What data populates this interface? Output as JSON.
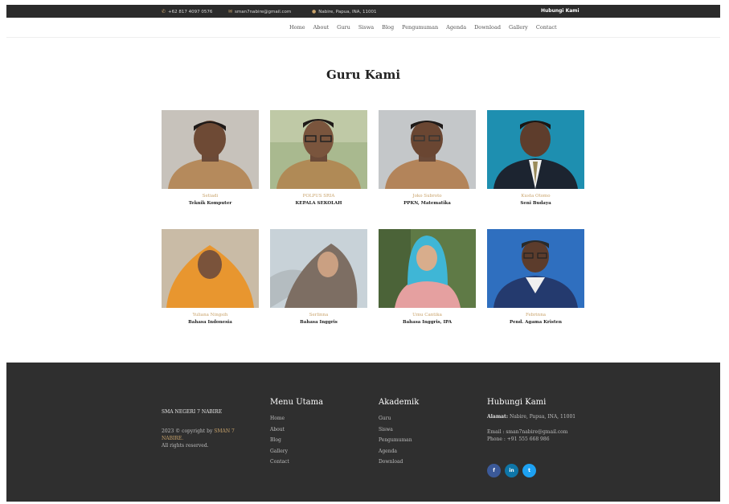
{
  "topbar": {
    "phone": "+62 817 4097 0576",
    "email": "sman7nabire@gmail.com",
    "address": "Nabire, Papua, INA, 11001",
    "cta": "Hubungi Kami",
    "icons": [
      "phone-icon",
      "mail-icon",
      "location-icon"
    ]
  },
  "nav": {
    "items": [
      "Home",
      "About",
      "Guru",
      "Siswa",
      "Blog",
      "Pengumuman",
      "Agenda",
      "Download",
      "Gallery",
      "Contact"
    ]
  },
  "page_title": "Guru Kami",
  "teachers": [
    {
      "name": "Setiadi",
      "role": "Teknik Komputer"
    },
    {
      "name": "POLPUS SRIA",
      "role": "KEPALA SEKOLAH"
    },
    {
      "name": "Joko Subroto",
      "role": "PPKN, Matematika"
    },
    {
      "name": "Kusta Otomo",
      "role": "Seni Budaya"
    },
    {
      "name": "Yuliana Ningsih",
      "role": "Bahasa Indonesia"
    },
    {
      "name": "Serlinna",
      "role": "Bahasa Inggris"
    },
    {
      "name": "Umu Cantika",
      "role": "Bahasa Inggris, IPA"
    },
    {
      "name": "Febrinna",
      "role": "Pend. Agama Kristen"
    }
  ],
  "footer": {
    "school": "SMA NEGERI 7 NABIRE",
    "copyright_prefix": "2023 © copyright by",
    "copyright_brand": "SMAN 7 NABIRE.",
    "rights": "All rights reserved.",
    "menu_title": "Menu Utama",
    "menu": [
      "Home",
      "About",
      "Blog",
      "Gallery",
      "Contact"
    ],
    "akademik_title": "Akademik",
    "akademik": [
      "Guru",
      "Siswa",
      "Pengumuman",
      "Agenda",
      "Download"
    ],
    "contact_title": "Hubungi Kami",
    "address_label": "Alamat:",
    "address": "Nabire, Papua, INA, 11001",
    "email_line": "Email : sman7nabire@gmail.com",
    "phone_line": "Phone : +91 555 668 986",
    "social": [
      {
        "label": "f",
        "color": "#3b5998"
      },
      {
        "label": "in",
        "color": "#0e76a8"
      },
      {
        "label": "t",
        "color": "#1da1f2"
      }
    ]
  },
  "colors": {
    "accent": "#c9a36b",
    "dark": "#2f2f2f"
  }
}
